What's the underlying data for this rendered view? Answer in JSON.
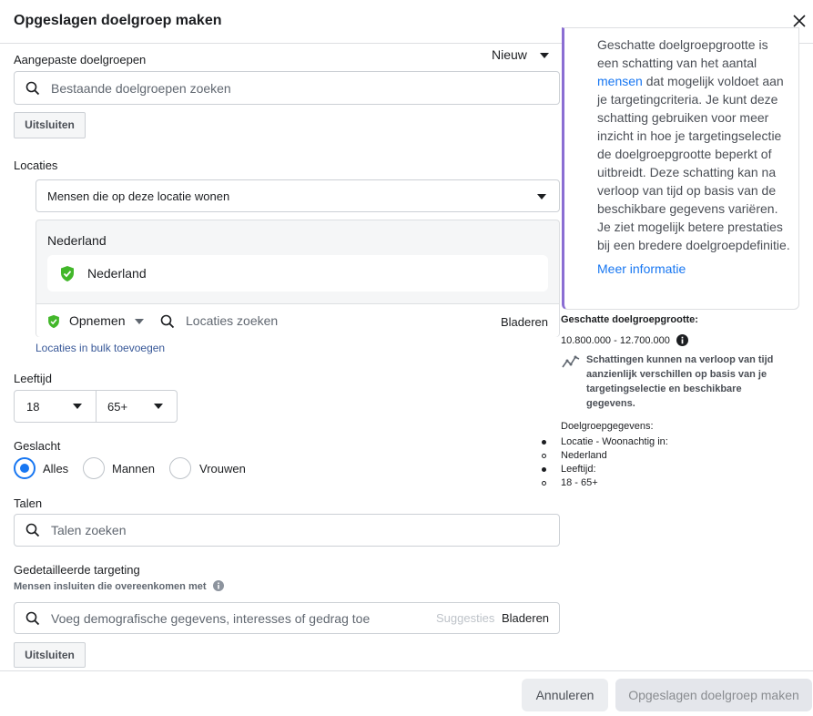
{
  "dialog": {
    "title": "Opgeslagen doelgroep maken"
  },
  "custom_audiences": {
    "label": "Aangepaste doelgroepen",
    "new_label": "Nieuw",
    "search_placeholder": "Bestaande doelgroepen zoeken",
    "exclude_label": "Uitsluiten"
  },
  "locations": {
    "label": "Locaties",
    "type_select": "Mensen die op deze locatie wonen",
    "group_header": "Nederland",
    "selected_item": "Nederland",
    "include_label": "Opnemen",
    "search_placeholder": "Locaties zoeken",
    "browse_label": "Bladeren",
    "bulk_link": "Locaties in bulk toevoegen"
  },
  "age": {
    "label": "Leeftijd",
    "min": "18",
    "max": "65+"
  },
  "gender": {
    "label": "Geslacht",
    "options": [
      "Alles",
      "Mannen",
      "Vrouwen"
    ],
    "selected": "Alles"
  },
  "languages": {
    "label": "Talen",
    "search_placeholder": "Talen zoeken"
  },
  "detailed_targeting": {
    "label": "Gedetailleerde targeting",
    "sublabel": "Mensen insluiten die overeenkomen met",
    "search_placeholder": "Voeg demografische gegevens, interesses of gedrag toe",
    "suggestions_label": "Suggesties",
    "browse_label": "Bladeren",
    "exclude_label": "Uitsluiten"
  },
  "info_card": {
    "text_top": "Geschatte doelgroepgrootte is",
    "text_line2": "een schatting van het aantal",
    "link_mensen": "mensen",
    "text_after_link": " dat mogelijk voldoet aan",
    "text_rest": "je targetingcriteria. Je kunt deze schatting gebruiken voor meer inzicht in hoe je targetingselectie de doelgroepgrootte beperkt of uitbreidt. Deze schatting kan na verloop van tijd op basis van de beschikbare gegevens variëren. Je ziet mogelijk betere prestaties bij een bredere doelgroepdefinitie.",
    "more_info_link": "Meer informatie"
  },
  "estimate": {
    "label": "Geschatte doelgroepgrootte:",
    "range": "10.800.000 - 12.700.000",
    "note": "Schattingen kunnen na verloop van tijd aanzienlijk verschillen op basis van je targetingselectie en beschikbare gegevens.",
    "details_label": "Doelgroepgegevens:",
    "details": [
      {
        "bullet": "disc",
        "text": "Locatie - Woonachtig in:"
      },
      {
        "bullet": "circle",
        "text": "Nederland"
      },
      {
        "bullet": "disc",
        "text": "Leeftijd:"
      },
      {
        "bullet": "circle",
        "text": "18 - 65+"
      }
    ]
  },
  "footer": {
    "cancel_label": "Annuleren",
    "create_label": "Opgeslagen doelgroep maken"
  },
  "colors": {
    "primary": "#1877f2",
    "link": "#385898",
    "accent_bar": "#8b6ed3",
    "check_green": "#42b72a"
  }
}
